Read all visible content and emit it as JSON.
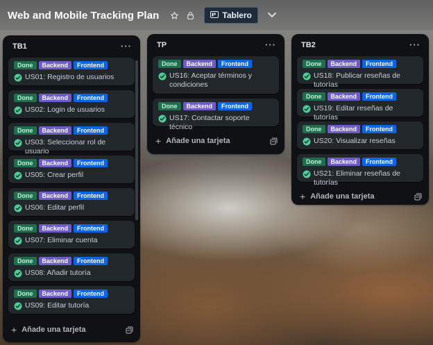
{
  "header": {
    "title": "Web and Mobile Tracking Plan",
    "view_label": "Tablero"
  },
  "label_texts": {
    "done": "Done",
    "backend": "Backend",
    "frontend": "Frontend"
  },
  "add_card_label": "Añade una tarjeta",
  "colors": {
    "done": "#216e4e",
    "backend": "#6e5dc6",
    "frontend": "#0c66e4",
    "check": "#4bce97",
    "list_bg": "#0f1114",
    "card_bg": "#22272b"
  },
  "icons": [
    "star-icon",
    "lock-icon",
    "board-icon",
    "chevron-down-icon",
    "more-icon",
    "check-circle-icon",
    "plus-icon",
    "template-icon"
  ],
  "lists": [
    {
      "title": "TB1",
      "cards": [
        {
          "title": "US01: Registro de usuarios"
        },
        {
          "title": "US02: Login de usuarios"
        },
        {
          "title": "US03: Seleccionar rol de usuario"
        },
        {
          "title": "US05: Crear perfil"
        },
        {
          "title": "US06: Editar perfil"
        },
        {
          "title": "US07: Eliminar cuenta"
        },
        {
          "title": "US08: Añadir tutoría"
        },
        {
          "title": "US09: Editar tutoría"
        }
      ]
    },
    {
      "title": "TP",
      "cards": [
        {
          "title": "US16: Aceptar términos y condiciones"
        },
        {
          "title": "US17: Contactar soporte técnico"
        }
      ]
    },
    {
      "title": "TB2",
      "cards": [
        {
          "title": "US18: Publicar reseñas de tutorías"
        },
        {
          "title": "US19: Editar reseñas de tutorías"
        },
        {
          "title": "US20: Visualizar reseñas"
        },
        {
          "title": "US21: Eliminar reseñas de tutorías"
        }
      ]
    }
  ]
}
